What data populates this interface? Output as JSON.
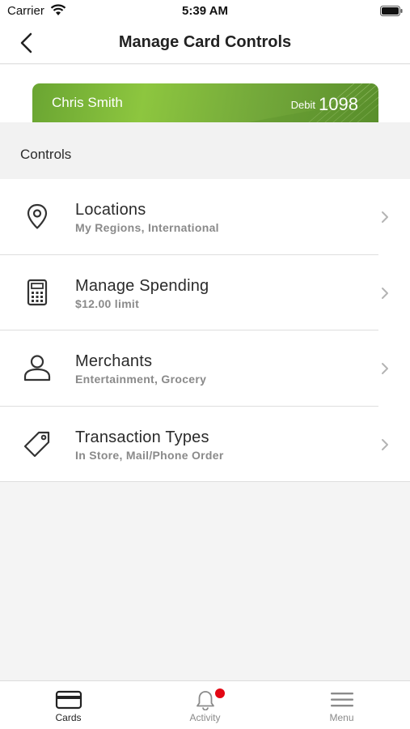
{
  "status_bar": {
    "carrier": "Carrier",
    "time": "5:39 AM"
  },
  "header": {
    "title": "Manage Card Controls"
  },
  "card": {
    "name": "Chris Smith",
    "type": "Debit",
    "last4": "1098",
    "color": "#8dc63f"
  },
  "section": {
    "title": "Controls"
  },
  "controls": [
    {
      "title": "Locations",
      "subtitle": "My Regions, International",
      "icon": "location-pin-icon"
    },
    {
      "title": "Manage Spending",
      "subtitle": "$12.00 limit",
      "icon": "calculator-icon"
    },
    {
      "title": "Merchants",
      "subtitle": "Entertainment, Grocery",
      "icon": "person-icon"
    },
    {
      "title": "Transaction Types",
      "subtitle": "In Store, Mail/Phone Order",
      "icon": "tag-icon"
    }
  ],
  "tabs": [
    {
      "label": "Cards",
      "icon": "card-icon",
      "active": true
    },
    {
      "label": "Activity",
      "icon": "bell-icon",
      "badge": true
    },
    {
      "label": "Menu",
      "icon": "hamburger-icon"
    }
  ],
  "colors": {
    "accent": "#8dc63f",
    "badge": "#e30613"
  }
}
